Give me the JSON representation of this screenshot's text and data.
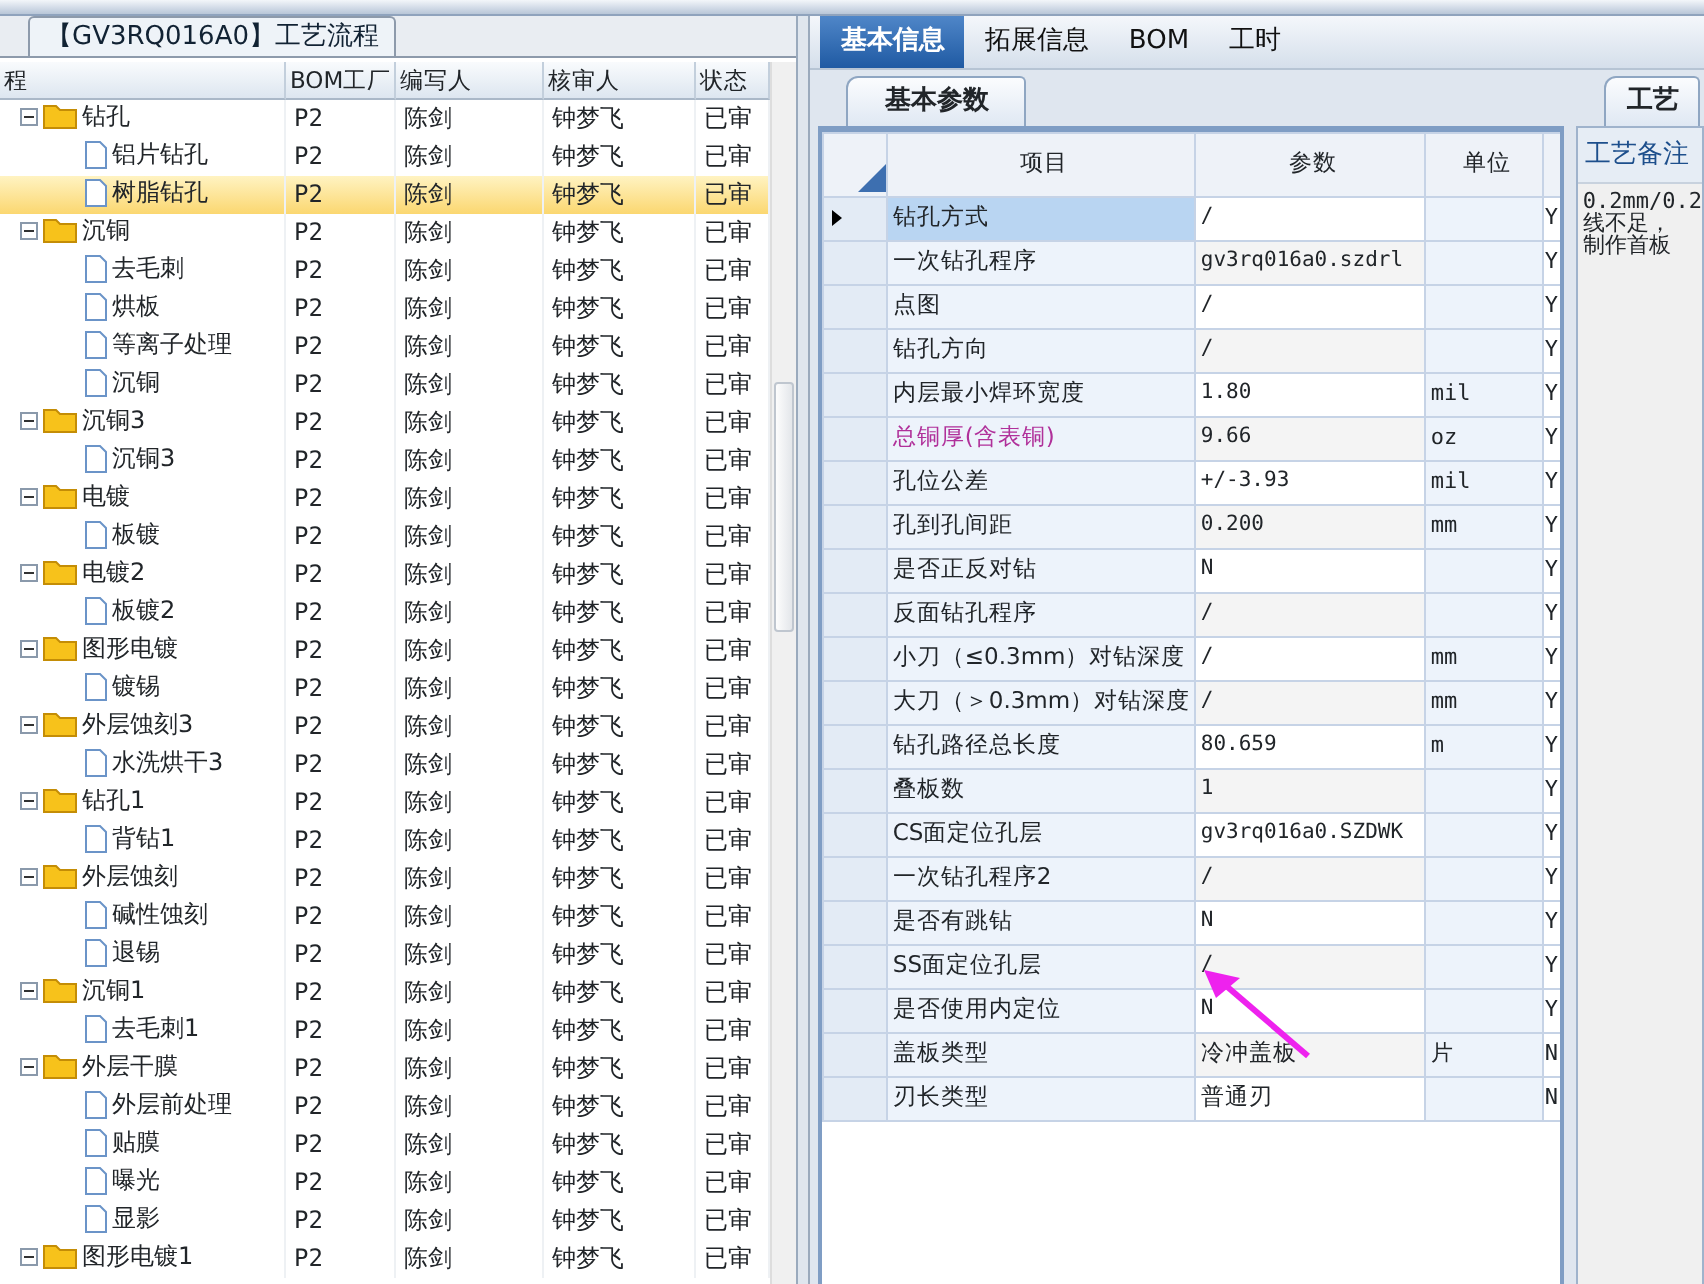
{
  "process_panel": {
    "tab": "【GV3RQ016A0】工艺流程",
    "columns": [
      "程",
      "BOM工厂",
      "编写人",
      "核审人",
      "状态"
    ],
    "tree": [
      {
        "name": "钻孔",
        "bom": "P2",
        "writer": "陈剑",
        "reviewer": "钟梦飞",
        "status": "已审",
        "expanded": true,
        "selected": false,
        "children": [
          {
            "name": "铝片钻孔",
            "bom": "P2",
            "writer": "陈剑",
            "reviewer": "钟梦飞",
            "status": "已审",
            "selected": false
          },
          {
            "name": "树脂钻孔",
            "bom": "P2",
            "writer": "陈剑",
            "reviewer": "钟梦飞",
            "status": "已审",
            "selected": true
          }
        ]
      },
      {
        "name": "沉铜",
        "bom": "P2",
        "writer": "陈剑",
        "reviewer": "钟梦飞",
        "status": "已审",
        "expanded": true,
        "selected": false,
        "children": [
          {
            "name": "去毛刺",
            "bom": "P2",
            "writer": "陈剑",
            "reviewer": "钟梦飞",
            "status": "已审",
            "selected": false
          },
          {
            "name": "烘板",
            "bom": "P2",
            "writer": "陈剑",
            "reviewer": "钟梦飞",
            "status": "已审",
            "selected": false
          },
          {
            "name": "等离子处理",
            "bom": "P2",
            "writer": "陈剑",
            "reviewer": "钟梦飞",
            "status": "已审",
            "selected": false
          },
          {
            "name": "沉铜",
            "bom": "P2",
            "writer": "陈剑",
            "reviewer": "钟梦飞",
            "status": "已审",
            "selected": false
          }
        ]
      },
      {
        "name": "沉铜3",
        "bom": "P2",
        "writer": "陈剑",
        "reviewer": "钟梦飞",
        "status": "已审",
        "expanded": true,
        "selected": false,
        "children": [
          {
            "name": "沉铜3",
            "bom": "P2",
            "writer": "陈剑",
            "reviewer": "钟梦飞",
            "status": "已审",
            "selected": false
          }
        ]
      },
      {
        "name": "电镀",
        "bom": "P2",
        "writer": "陈剑",
        "reviewer": "钟梦飞",
        "status": "已审",
        "expanded": true,
        "selected": false,
        "children": [
          {
            "name": "板镀",
            "bom": "P2",
            "writer": "陈剑",
            "reviewer": "钟梦飞",
            "status": "已审",
            "selected": false
          }
        ]
      },
      {
        "name": "电镀2",
        "bom": "P2",
        "writer": "陈剑",
        "reviewer": "钟梦飞",
        "status": "已审",
        "expanded": true,
        "selected": false,
        "children": [
          {
            "name": "板镀2",
            "bom": "P2",
            "writer": "陈剑",
            "reviewer": "钟梦飞",
            "status": "已审",
            "selected": false
          }
        ]
      },
      {
        "name": "图形电镀",
        "bom": "P2",
        "writer": "陈剑",
        "reviewer": "钟梦飞",
        "status": "已审",
        "expanded": true,
        "selected": false,
        "children": [
          {
            "name": "镀锡",
            "bom": "P2",
            "writer": "陈剑",
            "reviewer": "钟梦飞",
            "status": "已审",
            "selected": false
          }
        ]
      },
      {
        "name": "外层蚀刻3",
        "bom": "P2",
        "writer": "陈剑",
        "reviewer": "钟梦飞",
        "status": "已审",
        "expanded": true,
        "selected": false,
        "children": [
          {
            "name": "水洗烘干3",
            "bom": "P2",
            "writer": "陈剑",
            "reviewer": "钟梦飞",
            "status": "已审",
            "selected": false
          }
        ]
      },
      {
        "name": "钻孔1",
        "bom": "P2",
        "writer": "陈剑",
        "reviewer": "钟梦飞",
        "status": "已审",
        "expanded": true,
        "selected": false,
        "children": [
          {
            "name": "背钻1",
            "bom": "P2",
            "writer": "陈剑",
            "reviewer": "钟梦飞",
            "status": "已审",
            "selected": false
          }
        ]
      },
      {
        "name": "外层蚀刻",
        "bom": "P2",
        "writer": "陈剑",
        "reviewer": "钟梦飞",
        "status": "已审",
        "expanded": true,
        "selected": false,
        "children": [
          {
            "name": "碱性蚀刻",
            "bom": "P2",
            "writer": "陈剑",
            "reviewer": "钟梦飞",
            "status": "已审",
            "selected": false
          },
          {
            "name": "退锡",
            "bom": "P2",
            "writer": "陈剑",
            "reviewer": "钟梦飞",
            "status": "已审",
            "selected": false
          }
        ]
      },
      {
        "name": "沉铜1",
        "bom": "P2",
        "writer": "陈剑",
        "reviewer": "钟梦飞",
        "status": "已审",
        "expanded": true,
        "selected": false,
        "children": [
          {
            "name": "去毛刺1",
            "bom": "P2",
            "writer": "陈剑",
            "reviewer": "钟梦飞",
            "status": "已审",
            "selected": false
          }
        ]
      },
      {
        "name": "外层干膜",
        "bom": "P2",
        "writer": "陈剑",
        "reviewer": "钟梦飞",
        "status": "已审",
        "expanded": true,
        "selected": false,
        "children": [
          {
            "name": "外层前处理",
            "bom": "P2",
            "writer": "陈剑",
            "reviewer": "钟梦飞",
            "status": "已审",
            "selected": false
          },
          {
            "name": "贴膜",
            "bom": "P2",
            "writer": "陈剑",
            "reviewer": "钟梦飞",
            "status": "已审",
            "selected": false
          },
          {
            "name": "曝光",
            "bom": "P2",
            "writer": "陈剑",
            "reviewer": "钟梦飞",
            "status": "已审",
            "selected": false
          },
          {
            "name": "显影",
            "bom": "P2",
            "writer": "陈剑",
            "reviewer": "钟梦飞",
            "status": "已审",
            "selected": false
          }
        ]
      },
      {
        "name": "图形电镀1",
        "bom": "P2",
        "writer": "陈剑",
        "reviewer": "钟梦飞",
        "status": "已审",
        "expanded": true,
        "selected": false
      }
    ]
  },
  "tabs": [
    {
      "label": "基本信息",
      "selected": true
    },
    {
      "label": "拓展信息",
      "selected": false
    },
    {
      "label": "BOM",
      "selected": false
    },
    {
      "label": "工时",
      "selected": false
    }
  ],
  "subtab": {
    "label": "基本参数"
  },
  "param_grid": {
    "columns": [
      "项目",
      "参数",
      "单位"
    ],
    "rows": [
      {
        "item": "钻孔方式",
        "value": "/",
        "column_4": "Y",
        "selected": true,
        "highlighted": false
      },
      {
        "item": "一次钻孔程序",
        "value": "gv3rq016a0.szdrl",
        "column_4": "Y",
        "selected": false,
        "highlighted": false
      },
      {
        "item": "点图",
        "value": "/",
        "column_4": "Y",
        "selected": false,
        "highlighted": false
      },
      {
        "item": "钻孔方向",
        "value": "/",
        "column_4": "Y",
        "selected": false,
        "highlighted": false
      },
      {
        "item": "内层最小焊环宽度",
        "value": "1.80",
        "unit": "mil",
        "column_4": "Y",
        "selected": false,
        "highlighted": false
      },
      {
        "item": "总铜厚(含表铜)",
        "value": "9.66",
        "unit": "oz",
        "column_4": "Y",
        "selected": false,
        "highlighted": true
      },
      {
        "item": "孔位公差",
        "value": "+/-3.93",
        "unit": "mil",
        "column_4": "Y",
        "selected": false,
        "highlighted": false
      },
      {
        "item": "孔到孔间距",
        "value": "0.200",
        "unit": "mm",
        "column_4": "Y",
        "selected": false,
        "highlighted": false
      },
      {
        "item": "是否正反对钻",
        "value": "N",
        "column_4": "Y",
        "selected": false,
        "highlighted": false
      },
      {
        "item": "反面钻孔程序",
        "value": "/",
        "column_4": "Y",
        "selected": false,
        "highlighted": false
      },
      {
        "item": "小刀（≤0.3mm）对钻深度",
        "value": "/",
        "unit": "mm",
        "column_4": "Y",
        "selected": false,
        "highlighted": false
      },
      {
        "item": "大刀（＞0.3mm）对钻深度",
        "value": "/",
        "unit": "mm",
        "column_4": "Y",
        "selected": false,
        "highlighted": false
      },
      {
        "item": "钻孔路径总长度",
        "value": "80.659",
        "unit": "m",
        "column_4": "Y",
        "selected": false,
        "highlighted": false
      },
      {
        "item": "叠板数",
        "value": "1",
        "column_4": "Y",
        "selected": false,
        "highlighted": false
      },
      {
        "item": "CS面定位孔层",
        "value": "gv3rq016a0.SZDWK",
        "column_4": "Y",
        "selected": false,
        "highlighted": false
      },
      {
        "item": "一次钻孔程序2",
        "value": "/",
        "column_4": "Y",
        "selected": false,
        "highlighted": false
      },
      {
        "item": "是否有跳钻",
        "value": "N",
        "column_4": "Y",
        "selected": false,
        "highlighted": false
      },
      {
        "item": "SS面定位孔层",
        "value": "/",
        "column_4": "Y",
        "selected": false,
        "highlighted": false
      },
      {
        "item": "是否使用内定位",
        "value": "N",
        "column_4": "Y",
        "selected": false,
        "highlighted": false
      },
      {
        "item": "盖板类型",
        "value": "冷冲盖板",
        "unit": "片",
        "column_4": "N",
        "selected": false,
        "highlighted": false
      },
      {
        "item": "刃长类型",
        "value": "普通刃",
        "column_4": "N",
        "selected": false,
        "highlighted": false
      }
    ]
  },
  "notes_panel": {
    "tab": "工艺",
    "label": "工艺备注",
    "lines": [
      "0.2mm/0.2",
      "线不足，",
      "制作首板"
    ]
  }
}
